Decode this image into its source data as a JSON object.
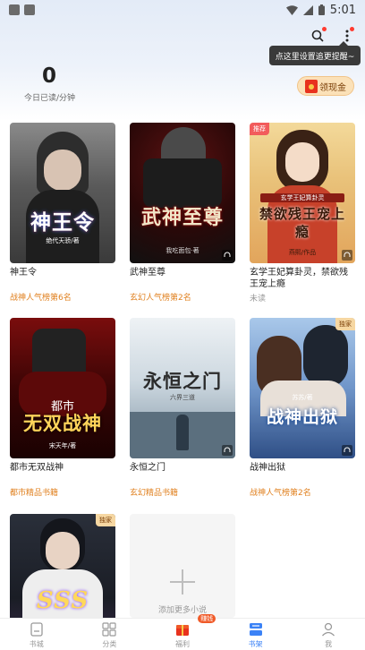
{
  "status_bar": {
    "time": "5:01"
  },
  "header": {
    "tooltip": "点这里设置追更提醒~",
    "read_time_value": "0",
    "read_time_label": "今日已读/分钟",
    "cash_button_label": "领现金"
  },
  "books": [
    {
      "name": "神王令",
      "tag": "战神人气榜第6名",
      "cover_title": "神王令",
      "cover_author": "绝代天骄/著"
    },
    {
      "name": "武神至尊",
      "tag": "玄幻人气榜第2名",
      "cover_title": "武神至尊",
      "cover_author": "我吃面包·著"
    },
    {
      "name": "玄学王妃算卦灵，禁欲残王宠上瘾",
      "status": "未读",
      "badge": "推荐",
      "cover_title": "禁欲残王宠上瘾",
      "cover_subtitle": "玄学王妃算卦灵",
      "cover_author": "燕熙/作品"
    },
    {
      "name": "都市无双战神",
      "tag": "都市精品书籍",
      "cover_title": "无双战神",
      "cover_subtitle": "都市",
      "cover_author": "宋天年/著"
    },
    {
      "name": "永恒之门",
      "tag": "玄幻精品书籍",
      "cover_title": "永恒之门",
      "cover_author": "六界三道"
    },
    {
      "name": "战神出狱",
      "tag": "战神人气榜第2名",
      "badge": "独家",
      "cover_title": "战神出狱",
      "cover_author": "苏苏/著"
    },
    {
      "name": "",
      "badge": "独家",
      "cover_title": "SSS"
    }
  ],
  "add_more_label": "添加更多小说",
  "bottom_nav": {
    "items": [
      {
        "label": "书城",
        "icon": "bookstore-icon"
      },
      {
        "label": "分类",
        "icon": "category-icon"
      },
      {
        "label": "福利",
        "icon": "gift-icon",
        "badge": "赚钱"
      },
      {
        "label": "书架",
        "icon": "bookshelf-icon",
        "active": true
      },
      {
        "label": "我",
        "icon": "profile-icon"
      }
    ]
  },
  "colors": {
    "accent": "#3b82f6",
    "tag": "#e0801f",
    "badge": "#f05a28"
  }
}
